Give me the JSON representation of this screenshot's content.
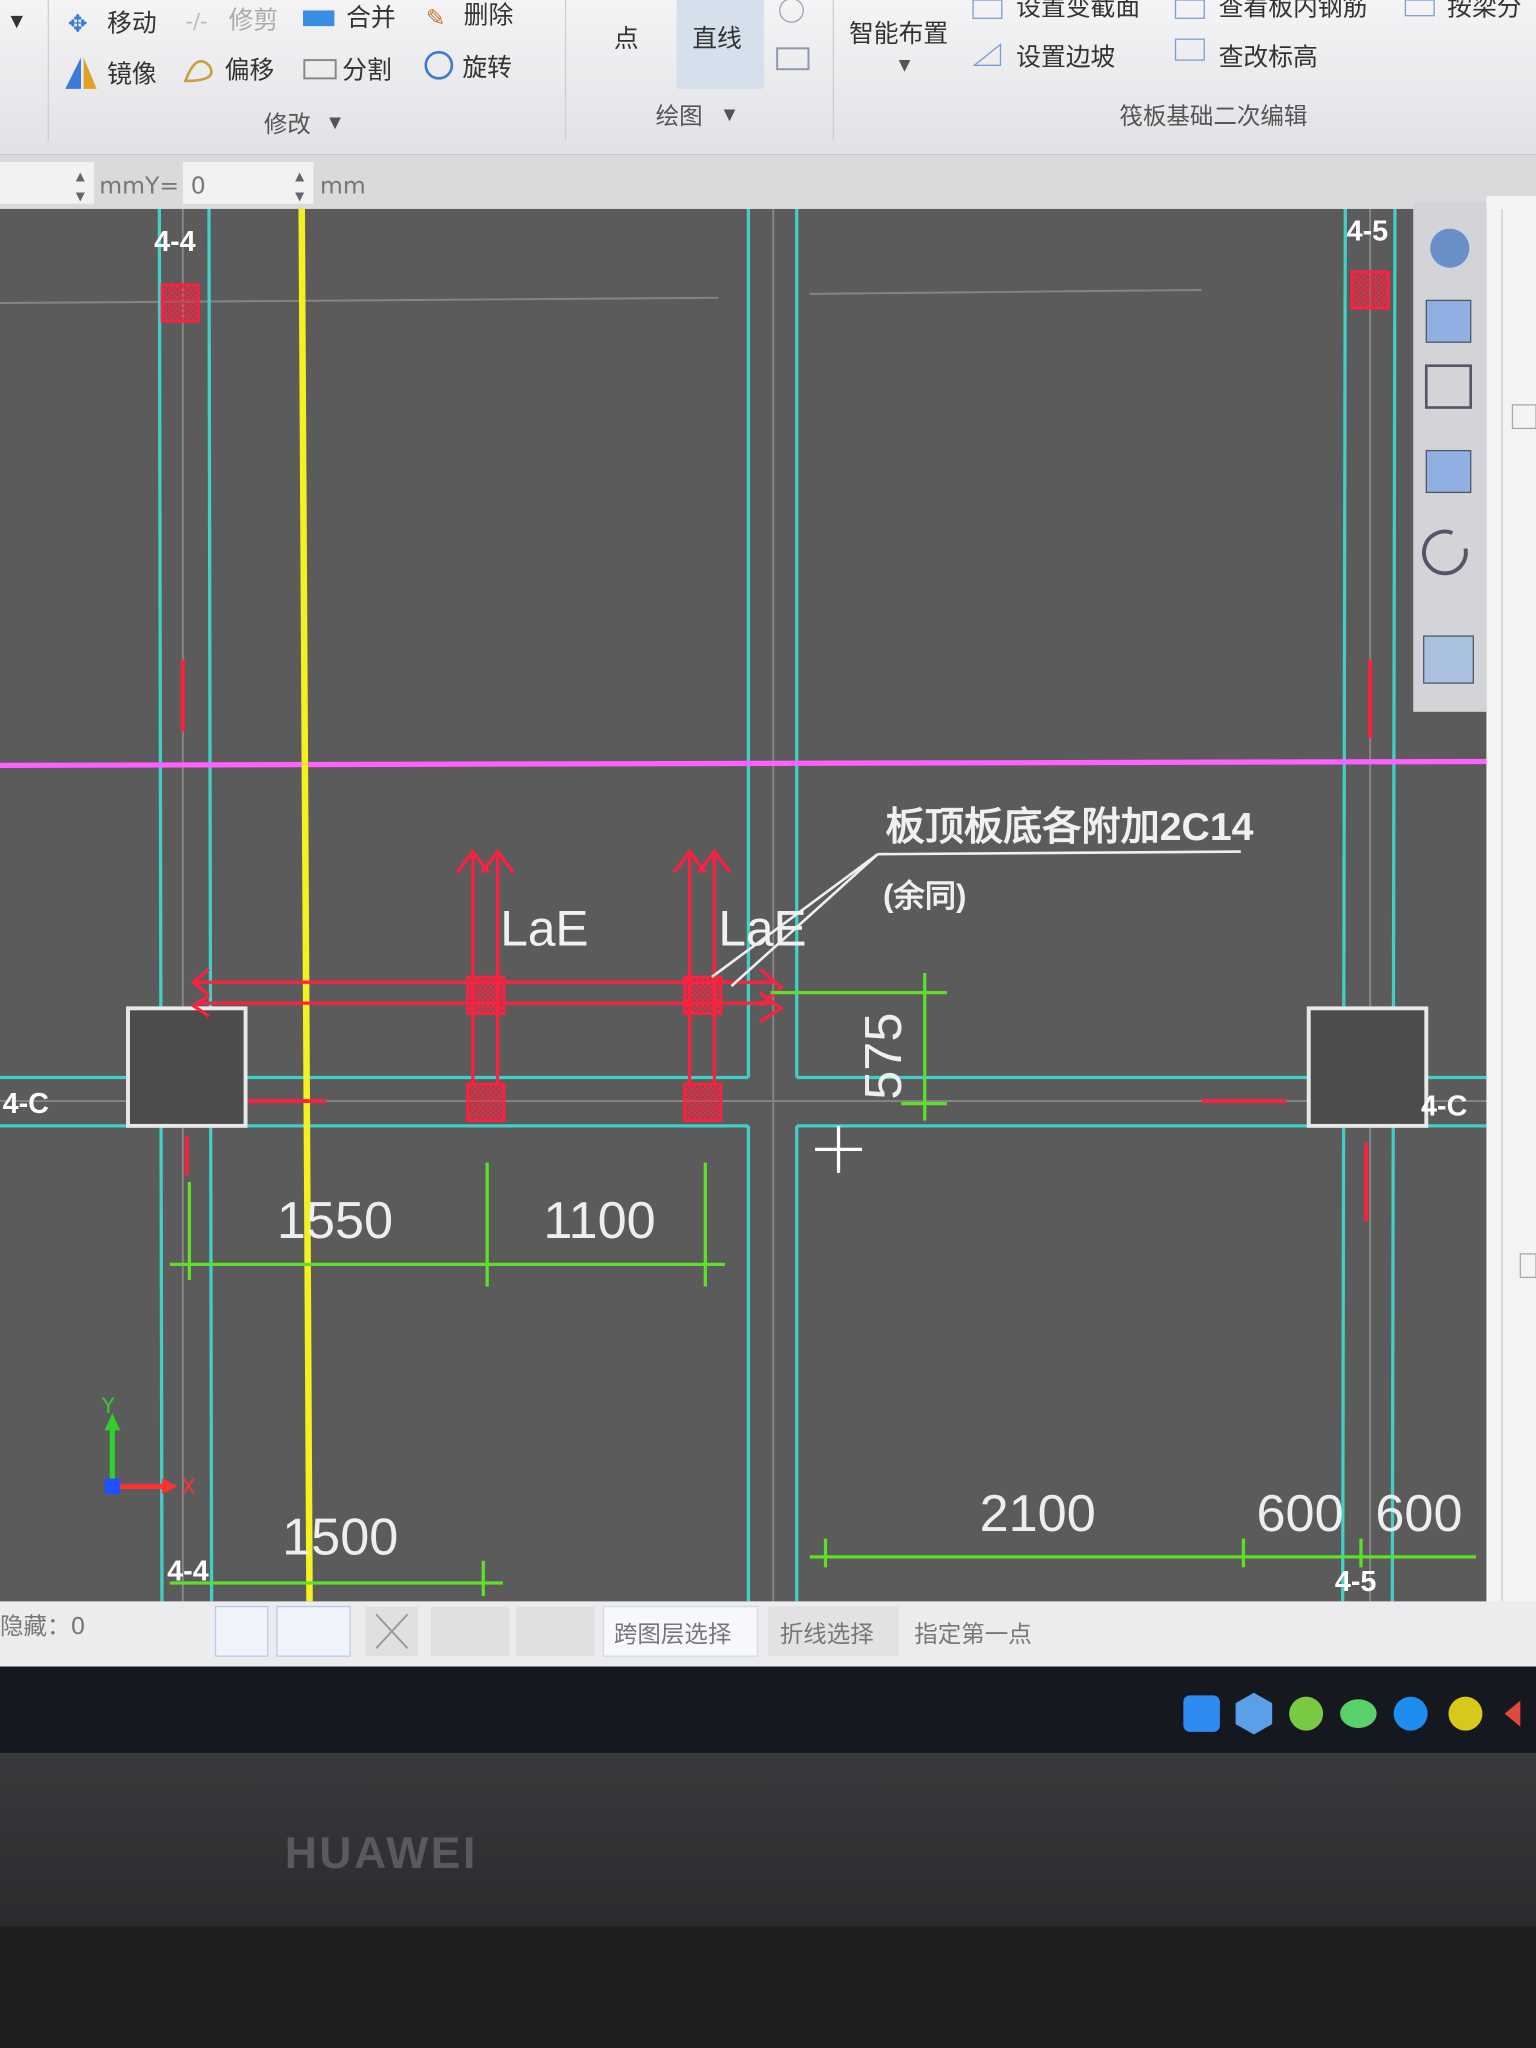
{
  "ribbon": {
    "modify": {
      "items": [
        "移动",
        "修剪",
        "合并",
        "删除",
        "镜像",
        "偏移",
        "分割",
        "旋转"
      ],
      "group_label": "修改"
    },
    "draw": {
      "items": [
        "点",
        "直线"
      ],
      "group_label": "绘图"
    },
    "raft": {
      "smart_layout": "智能布置",
      "items": [
        "设置变截面",
        "设置边坡",
        "查看板内钢筋",
        "查改标高",
        "按梁分"
      ],
      "group_label": "筏板基础二次编辑"
    }
  },
  "coord_bar": {
    "x_value": "",
    "y_label": "mmY=",
    "y_value": "0",
    "unit": "mm"
  },
  "drawing": {
    "axis_labels": {
      "top_left": "4-4",
      "bottom_left": "4-4",
      "top_right": "4-5",
      "bottom_right": "4-5",
      "left": "4-C",
      "right": "4-C"
    },
    "lae_labels": [
      "LaE",
      "LaE"
    ],
    "annotation": {
      "line1": "板顶板底各附加2C14",
      "line2": "(余同)"
    },
    "dimensions": {
      "d1": "1550",
      "d2": "1100",
      "d3": "575",
      "d4": "1500",
      "d5": "2100",
      "d6": "600",
      "d7": "600"
    },
    "ucs": {
      "x": "X",
      "y": "Y"
    },
    "colors": {
      "canvas": "#5b5b5b",
      "axis_line": "#40d0c8",
      "rebar": "#ff2040",
      "dimension": "#5ee02a",
      "yellow_line": "#f5f020",
      "magenta_line": "#ff60ff"
    }
  },
  "status_bar": {
    "hidden_label": "隐藏：0",
    "cross_layer_select": "跨图层选择",
    "polyline_select": "折线选择",
    "prompt": "指定第一点"
  },
  "taskbar": {
    "tray_icons": [
      "k-icon",
      "cube-app-icon",
      "green-app-icon",
      "wechat-icon",
      "browser-icon",
      "yellow-app-icon",
      "volume-icon"
    ]
  },
  "bezel": {
    "brand": "HUAWEI"
  }
}
